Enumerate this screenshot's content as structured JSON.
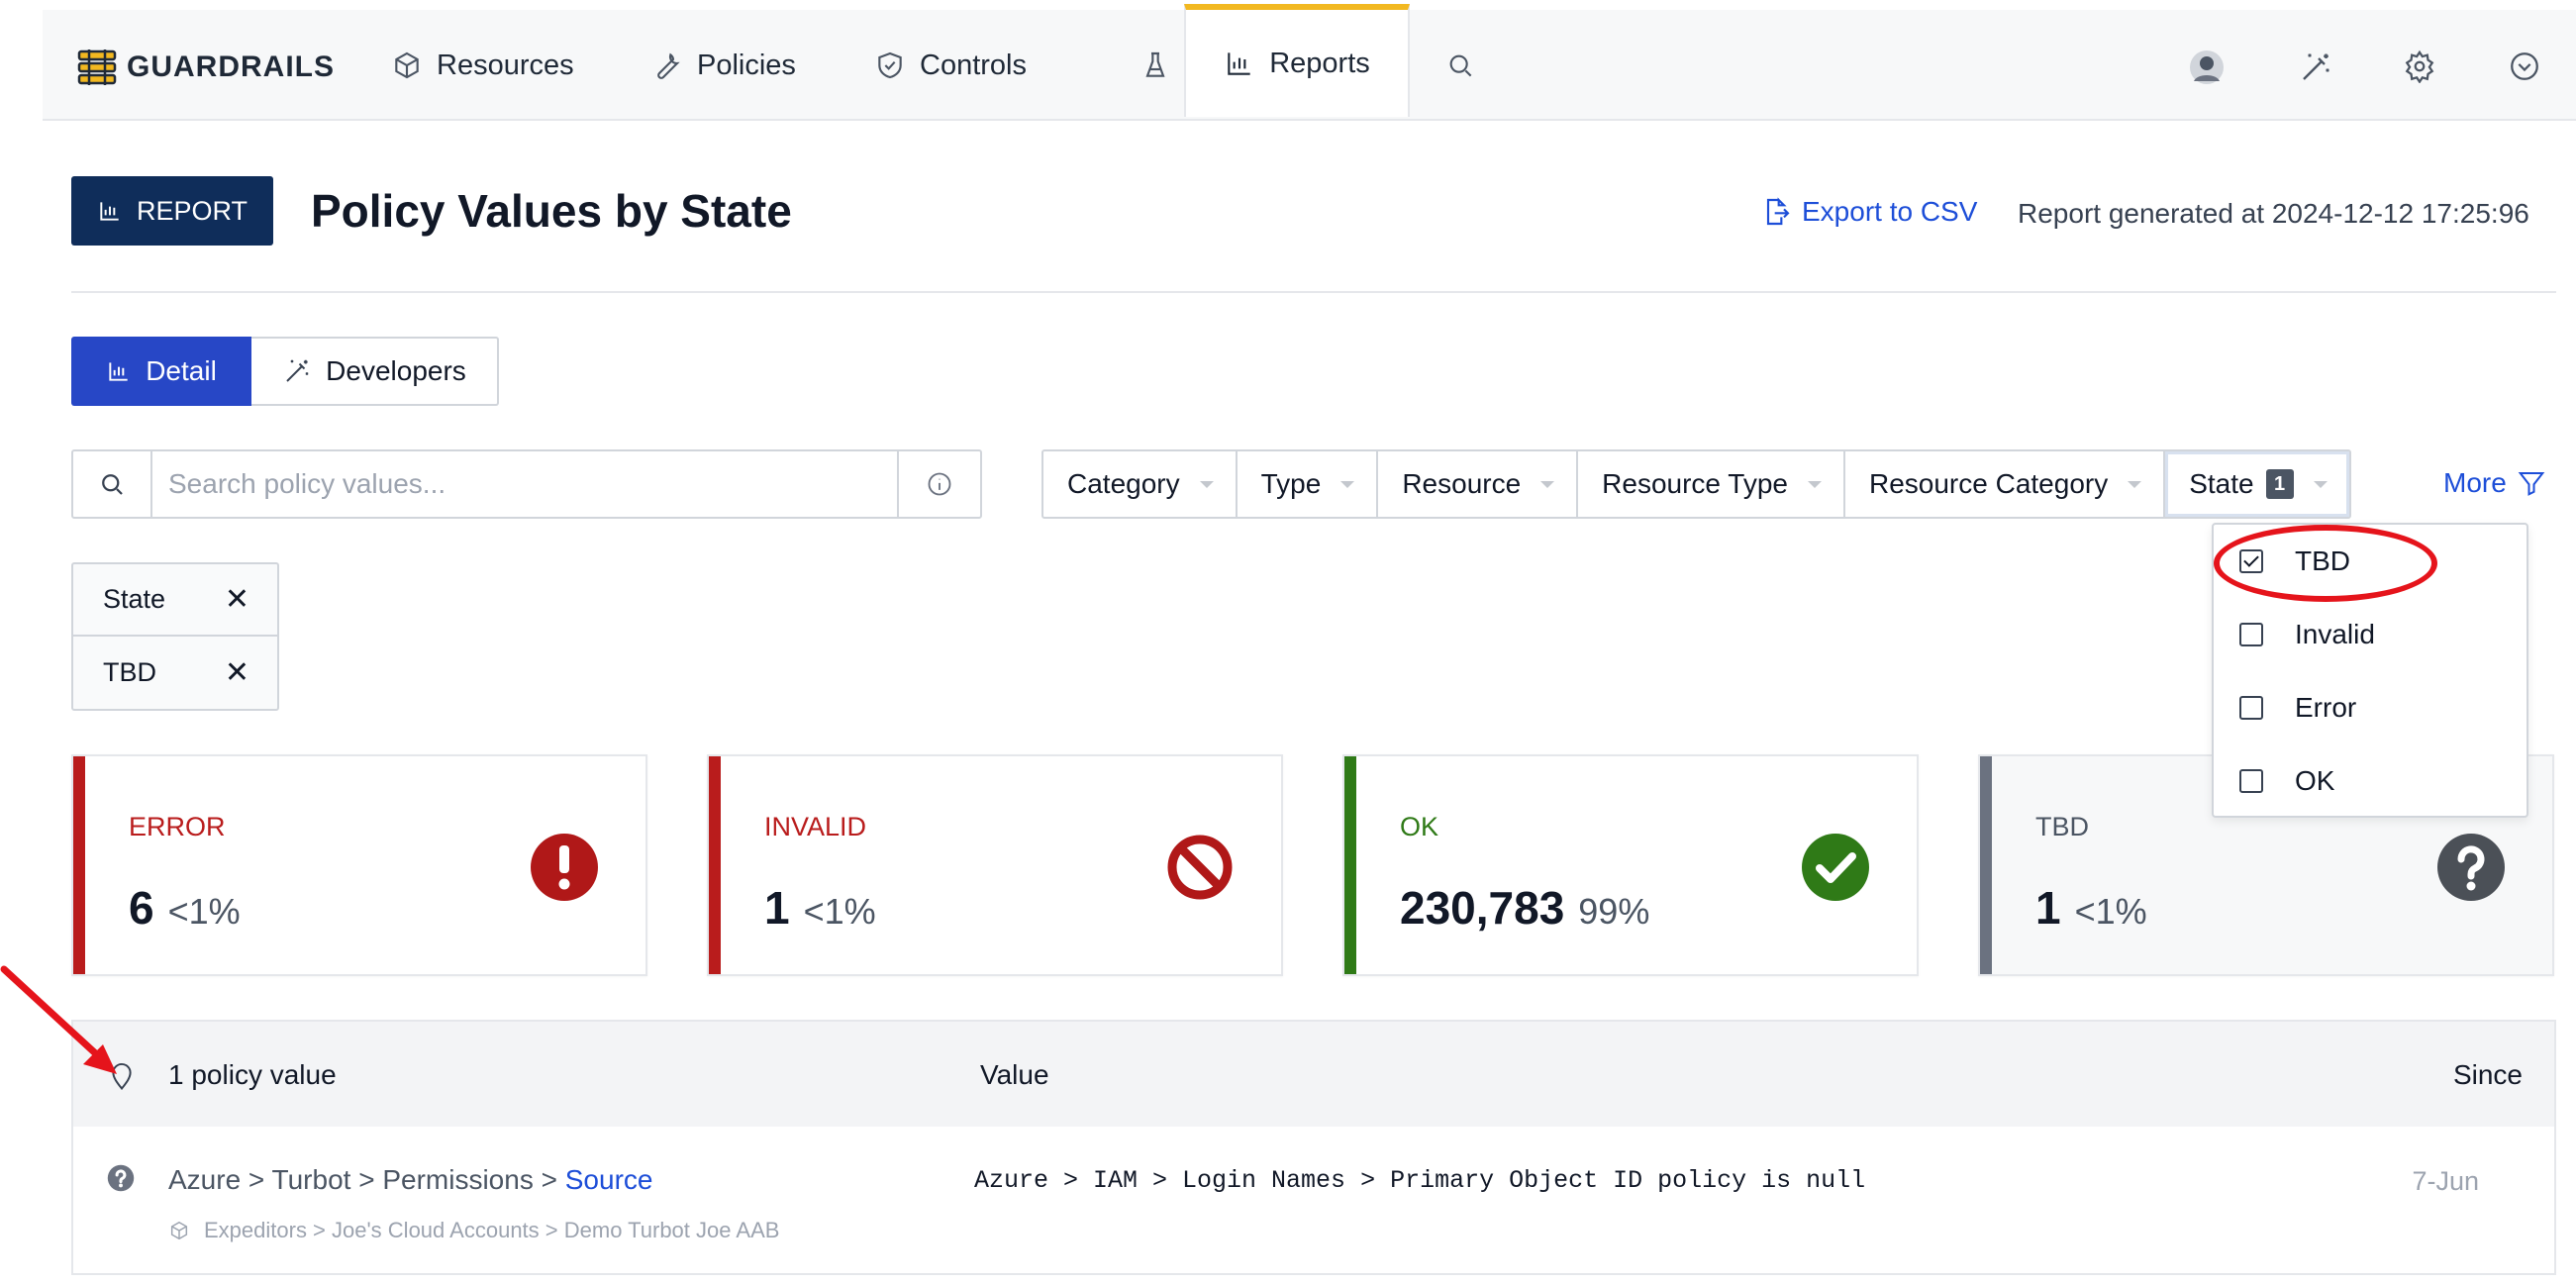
{
  "nav": {
    "brand": "GUARDRAILS",
    "items": [
      {
        "label": "Resources",
        "icon": "cube-icon"
      },
      {
        "label": "Policies",
        "icon": "wrench-icon"
      },
      {
        "label": "Controls",
        "icon": "shield-check-icon"
      },
      {
        "label": "",
        "icon": "flask-icon"
      },
      {
        "label": "Reports",
        "icon": "bar-chart-icon",
        "active": true
      },
      {
        "label": "",
        "icon": "search-icon"
      }
    ],
    "right_icons": [
      "avatar",
      "magic-wand-icon",
      "gear-icon",
      "chevron-circle-icon"
    ]
  },
  "header": {
    "badge": "REPORT",
    "title": "Policy Values by State",
    "export_label": "Export to CSV",
    "generated": "Report generated at 2024-12-12 17:25:96"
  },
  "view_tabs": {
    "detail": "Detail",
    "developers": "Developers"
  },
  "search": {
    "placeholder": "Search policy values..."
  },
  "filters": {
    "items": [
      "Category",
      "Type",
      "Resource",
      "Resource Type",
      "Resource Category",
      "State"
    ],
    "state_count": "1",
    "more": "More"
  },
  "applied": {
    "key": "State",
    "value": "TBD"
  },
  "state_dropdown": {
    "options": [
      {
        "label": "TBD",
        "checked": true
      },
      {
        "label": "Invalid",
        "checked": false
      },
      {
        "label": "Error",
        "checked": false
      },
      {
        "label": "OK",
        "checked": false
      }
    ]
  },
  "cards": [
    {
      "label": "ERROR",
      "value": "6",
      "pct": "<1%",
      "color": "#b91c1c"
    },
    {
      "label": "INVALID",
      "value": "1",
      "pct": "<1%",
      "color": "#b91c1c"
    },
    {
      "label": "OK",
      "value": "230,783",
      "pct": "99%",
      "color": "#2f7a17"
    },
    {
      "label": "TBD",
      "value": "1",
      "pct": "<1%",
      "color": "#6b7280"
    }
  ],
  "table": {
    "count_label": "1 policy value",
    "col_value": "Value",
    "col_since": "Since",
    "rows": [
      {
        "path_prefix": "Azure > Turbot > Permissions > ",
        "path_link": "Source",
        "resource": "Expeditors > Joe's Cloud Accounts > Demo Turbot Joe AAB",
        "value": "Azure > IAM > Login Names > Primary Object ID policy is null",
        "since": "7-Jun"
      }
    ]
  }
}
